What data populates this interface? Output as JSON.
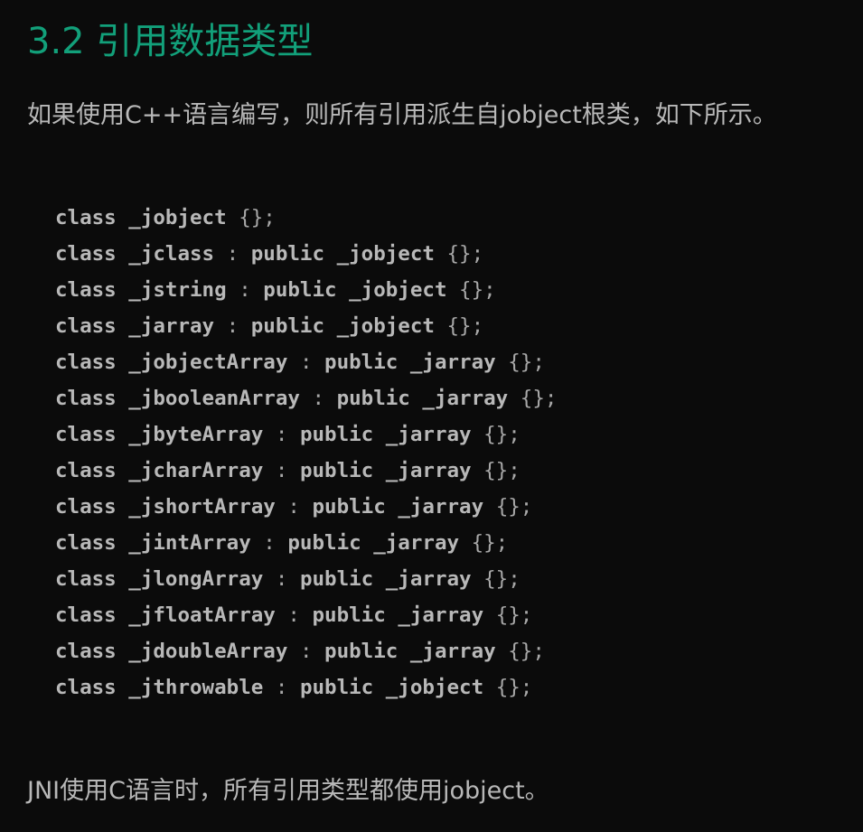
{
  "heading": "3.2 引用数据类型",
  "intro": "如果使用C++语言编写，则所有引用派生自jobject根类，如下所示。",
  "code_lines": [
    {
      "kw": "class",
      "name": "_jobject",
      "parent": "",
      "body": "{};"
    },
    {
      "kw": "class",
      "name": "_jclass",
      "parent": "_jobject",
      "body": "{};"
    },
    {
      "kw": "class",
      "name": "_jstring",
      "parent": "_jobject",
      "body": "{};"
    },
    {
      "kw": "class",
      "name": "_jarray",
      "parent": "_jobject",
      "body": "{};"
    },
    {
      "kw": "class",
      "name": "_jobjectArray",
      "parent": "_jarray",
      "body": "{};"
    },
    {
      "kw": "class",
      "name": "_jbooleanArray",
      "parent": "_jarray",
      "body": "{};"
    },
    {
      "kw": "class",
      "name": "_jbyteArray",
      "parent": "_jarray",
      "body": "{};"
    },
    {
      "kw": "class",
      "name": "_jcharArray",
      "parent": "_jarray",
      "body": "{};"
    },
    {
      "kw": "class",
      "name": "_jshortArray",
      "parent": "_jarray",
      "body": "{};"
    },
    {
      "kw": "class",
      "name": "_jintArray",
      "parent": "_jarray",
      "body": "{};"
    },
    {
      "kw": "class",
      "name": "_jlongArray",
      "parent": "_jarray",
      "body": "{};"
    },
    {
      "kw": "class",
      "name": "_jfloatArray",
      "parent": "_jarray",
      "body": "{};"
    },
    {
      "kw": "class",
      "name": "_jdoubleArray",
      "parent": "_jarray",
      "body": "{};"
    },
    {
      "kw": "class",
      "name": "_jthrowable",
      "parent": "_jobject",
      "body": "{};"
    }
  ],
  "code_tokens": {
    "colon": ":",
    "public": "public"
  },
  "outro": "JNI使用C语言时，所有引用类型都使用jobject。",
  "colors": {
    "background": "#0b0b0b",
    "heading": "#12a07a",
    "text": "#b8b8b8"
  }
}
